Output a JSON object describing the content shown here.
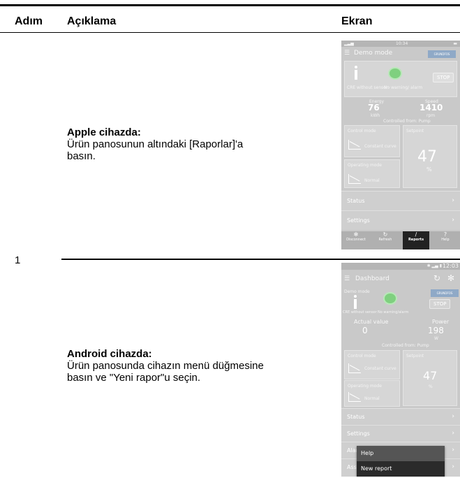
{
  "header": {
    "col_step": "Adım",
    "col_desc": "Açıklama",
    "col_screen": "Ekran"
  },
  "step": {
    "number": "1"
  },
  "apple": {
    "title": "Apple cihazda:",
    "line1": "Ürün panosunun altındaki [Raporlar]'a",
    "line2": "basın."
  },
  "android": {
    "title": "Android cihazda:",
    "line1": "Ürün panosunda cihazın menü düğmesine",
    "line2": "basın ve \"Yeni rapor\"u seçin."
  },
  "ios_screen": {
    "time": "10:34",
    "title": "Demo mode",
    "brand": "GRUNDFOS",
    "sensor_label": "CRE without sensor",
    "warning_label": "No warning/ alarm",
    "stop": "STOP",
    "energy_label": "Energy",
    "energy_value": "76",
    "energy_unit": "kWh",
    "speed_label": "Speed",
    "speed_value": "1410",
    "speed_unit": "rpm",
    "controlled_from": "Controlled from: Pump",
    "control_mode": "Control mode",
    "control_curve": "Constant curve",
    "setpoint": "Setpoint",
    "setpoint_value": "47",
    "setpoint_unit": "%",
    "operating_mode": "Operating mode",
    "operating_value": "Normal",
    "status": "Status",
    "settings": "Settings",
    "tab_disconnect": "Disconnect",
    "tab_refresh": "Refresh",
    "tab_reports": "Reports",
    "tab_help": "Help"
  },
  "android_screen": {
    "time": "12:03",
    "title": "Dashboard",
    "demo_mode": "Demo mode",
    "brand": "GRUNDFOS",
    "sensor_label": "CRE without sensor",
    "warning_label": "No warning/alarm",
    "stop": "STOP",
    "actual_label": "Actual value",
    "actual_value": "0",
    "power_label": "Power",
    "power_value": "198",
    "power_unit": "W",
    "controlled_from": "Controlled from: Pump",
    "control_mode": "Control mode",
    "control_curve": "Constant curve",
    "setpoint": "Setpoint",
    "setpoint_value": "47",
    "setpoint_unit": "%",
    "operating_mode": "Operating mode",
    "operating_value": "Normal",
    "status": "Status",
    "settings": "Settings",
    "alarms_partial": "Alar",
    "assist_partial": "Assi",
    "menu_help": "Help",
    "menu_new_report": "New report"
  }
}
